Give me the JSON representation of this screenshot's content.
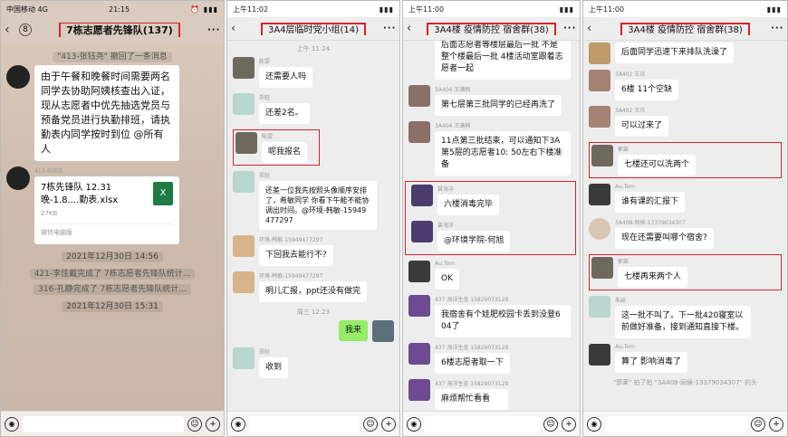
{
  "panel1": {
    "status_left": "中国移动 4G",
    "status_time": "21:15",
    "back_count": "8",
    "title": "7栋志愿者先锋队(137)",
    "recall_notice": "\"413-张钰尧\" 撤回了一条消息",
    "msg1": "由于午餐和晚餐时间需要两名同学去协助阿姨核查出入证，现从志愿者中优先抽选党员与预备党员进行执勤排班，请执勤表内同学按时到位 @所有人",
    "sender2": "413-张钰尧",
    "file_name": "7栋先锋队 12.31晚-1.8....勤表.xlsx",
    "file_size": "27KB",
    "file_src": "微信电脑版",
    "time1": "2021年12月30日 14:56",
    "sys1": "421-李佳戴完成了 7栋志愿者先锋队统计...",
    "sys2": "316-孔静完成了 7栋志愿者先锋队统计...",
    "time2": "2021年12月30日 15:31"
  },
  "panel2": {
    "status_time": "上午11:02",
    "title": "3A4层临时党小组(14)",
    "time_top": "上午 11:24",
    "n1": "陈雯",
    "m1": "还需要人吗",
    "n2": "郑轻",
    "m2": "还差2名。",
    "n3": "陈雯",
    "m3": "呢我报名",
    "n4": "郑轻",
    "m4": "还差一位我先按照头像顺序安排了，希敏同学 你看下午能不能协调出时间。@环境-韩敏-15949477297",
    "n5": "环境-韩敏-15949477297",
    "m5": "下回我去能行不?",
    "n6": "环境-韩敏-15949477297",
    "m6": "明儿汇报，ppt还没有做完",
    "time2": "周三 12:23",
    "m7": "我来",
    "n8": "郑轻",
    "m8": "收到"
  },
  "panel3": {
    "status_time": "上午11:00",
    "title": "3A4楼 疫情防控 宿舍群(38)",
    "m0": "后面志愿者等楼层最后一批 不是整个楼最后一批 4楼活动室跟着志愿者一起",
    "n1": "3A404 王满楠",
    "m1": "第七层第三批同学的已经再洗了",
    "n2": "3A404 王满楠",
    "m2": "11点第三批结束，可以通知下3A第5层的志愿者10: 50左右下楼准备",
    "n3": "曾海洋",
    "m3": "六楼消毒完毕",
    "n4": "曾海洋",
    "m4": "@环境学院-何旭",
    "n5": "Au.Tom",
    "m5": "OK",
    "n6": "437 海洋生态 15829073129",
    "m6": "我宿舍有个娃肥校园卡丢到没登604了",
    "n7": "437 海洋生态 15829073129",
    "m7": "6楼志愿者取一下",
    "n8": "437 海洋生态 15829073129",
    "m8": "麻烦帮忙看看"
  },
  "panel4": {
    "status_time": "上午11:00",
    "title": "3A4楼 疫情防控 宿舍群(38)",
    "m0": "后面同学迅速下来排队洗澡了",
    "n1": "3A402 王兵",
    "m1": "6楼 11个空缺",
    "n2": "3A402 王兵",
    "m2": "可以过来了",
    "n3": "郭莱",
    "m3": "七楼还可以洗两个",
    "n4": "Au.Tom",
    "m4": "谁有课的汇报下",
    "n5": "3A408-同侯-13379034307",
    "m5": "现在还需要叫哪个宿舍?",
    "n6": "郭莱",
    "m6": "七楼再来两个人",
    "n7": "朱妹",
    "m7": "这一批不叫了。下一批420寝室以前做好准备，接到通知直接下楼。",
    "n8": "Au.Tom",
    "m8": "算了 影响消毒了",
    "sys": "\"郭莱\" 拍了拍 \"3A408-同侯-13379034307\" 的头"
  }
}
